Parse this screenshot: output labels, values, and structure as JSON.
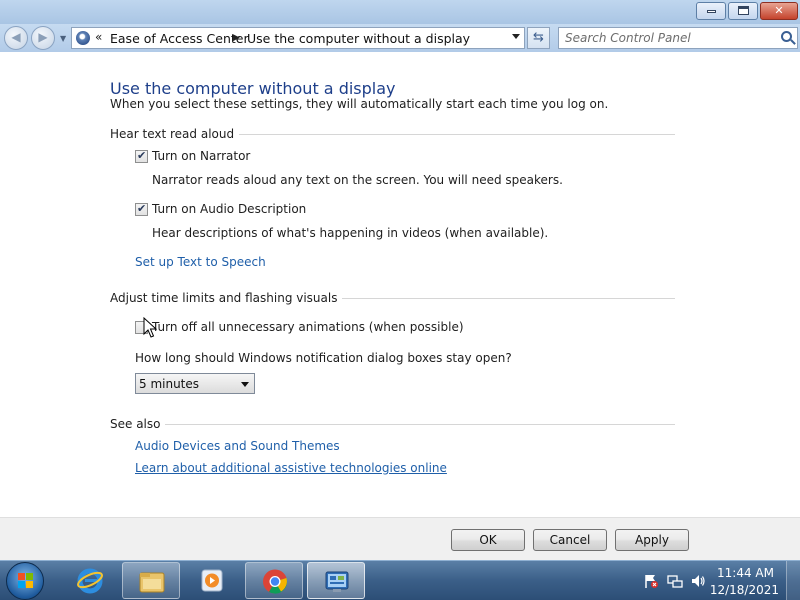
{
  "window": {
    "controls": [
      "minimize",
      "maximize",
      "close"
    ]
  },
  "nav": {
    "breadcrumbs": [
      "Ease of Access Center",
      "Use the computer without a display"
    ],
    "search_placeholder": "Search Control Panel"
  },
  "page": {
    "title": "Use the computer without a display",
    "subtitle": "When you select these settings, they will automatically start each time you log on."
  },
  "sections": {
    "hear_text": {
      "title": "Hear text read aloud",
      "narrator": {
        "label": "Turn on Narrator",
        "checked": true,
        "description": "Narrator reads aloud any text on the screen. You will need speakers."
      },
      "audio_description": {
        "label": "Turn on Audio Description",
        "checked": true,
        "description": "Hear descriptions of what's happening in videos (when available)."
      },
      "link": "Set up Text to Speech"
    },
    "time_limits": {
      "title": "Adjust time limits and flashing visuals",
      "animations": {
        "label": "Turn off all unnecessary animations (when possible)",
        "checked": false
      },
      "question": "How long should Windows notification dialog boxes stay open?",
      "duration_value": "5 minutes"
    },
    "see_also": {
      "title": "See also",
      "links": [
        "Audio Devices and Sound Themes",
        "Learn about additional assistive technologies online"
      ]
    }
  },
  "buttons": {
    "ok": "OK",
    "cancel": "Cancel",
    "apply": "Apply"
  },
  "taskbar": {
    "items": [
      "start-button",
      "internet-explorer",
      "windows-explorer",
      "media-player",
      "chrome",
      "control-panel"
    ],
    "time": "11:44 AM",
    "date": "12/18/2021"
  },
  "colors": {
    "title_blue": "#1e3f8a",
    "link_blue": "#1f5fa9",
    "taskbar": "#3b5f88"
  }
}
